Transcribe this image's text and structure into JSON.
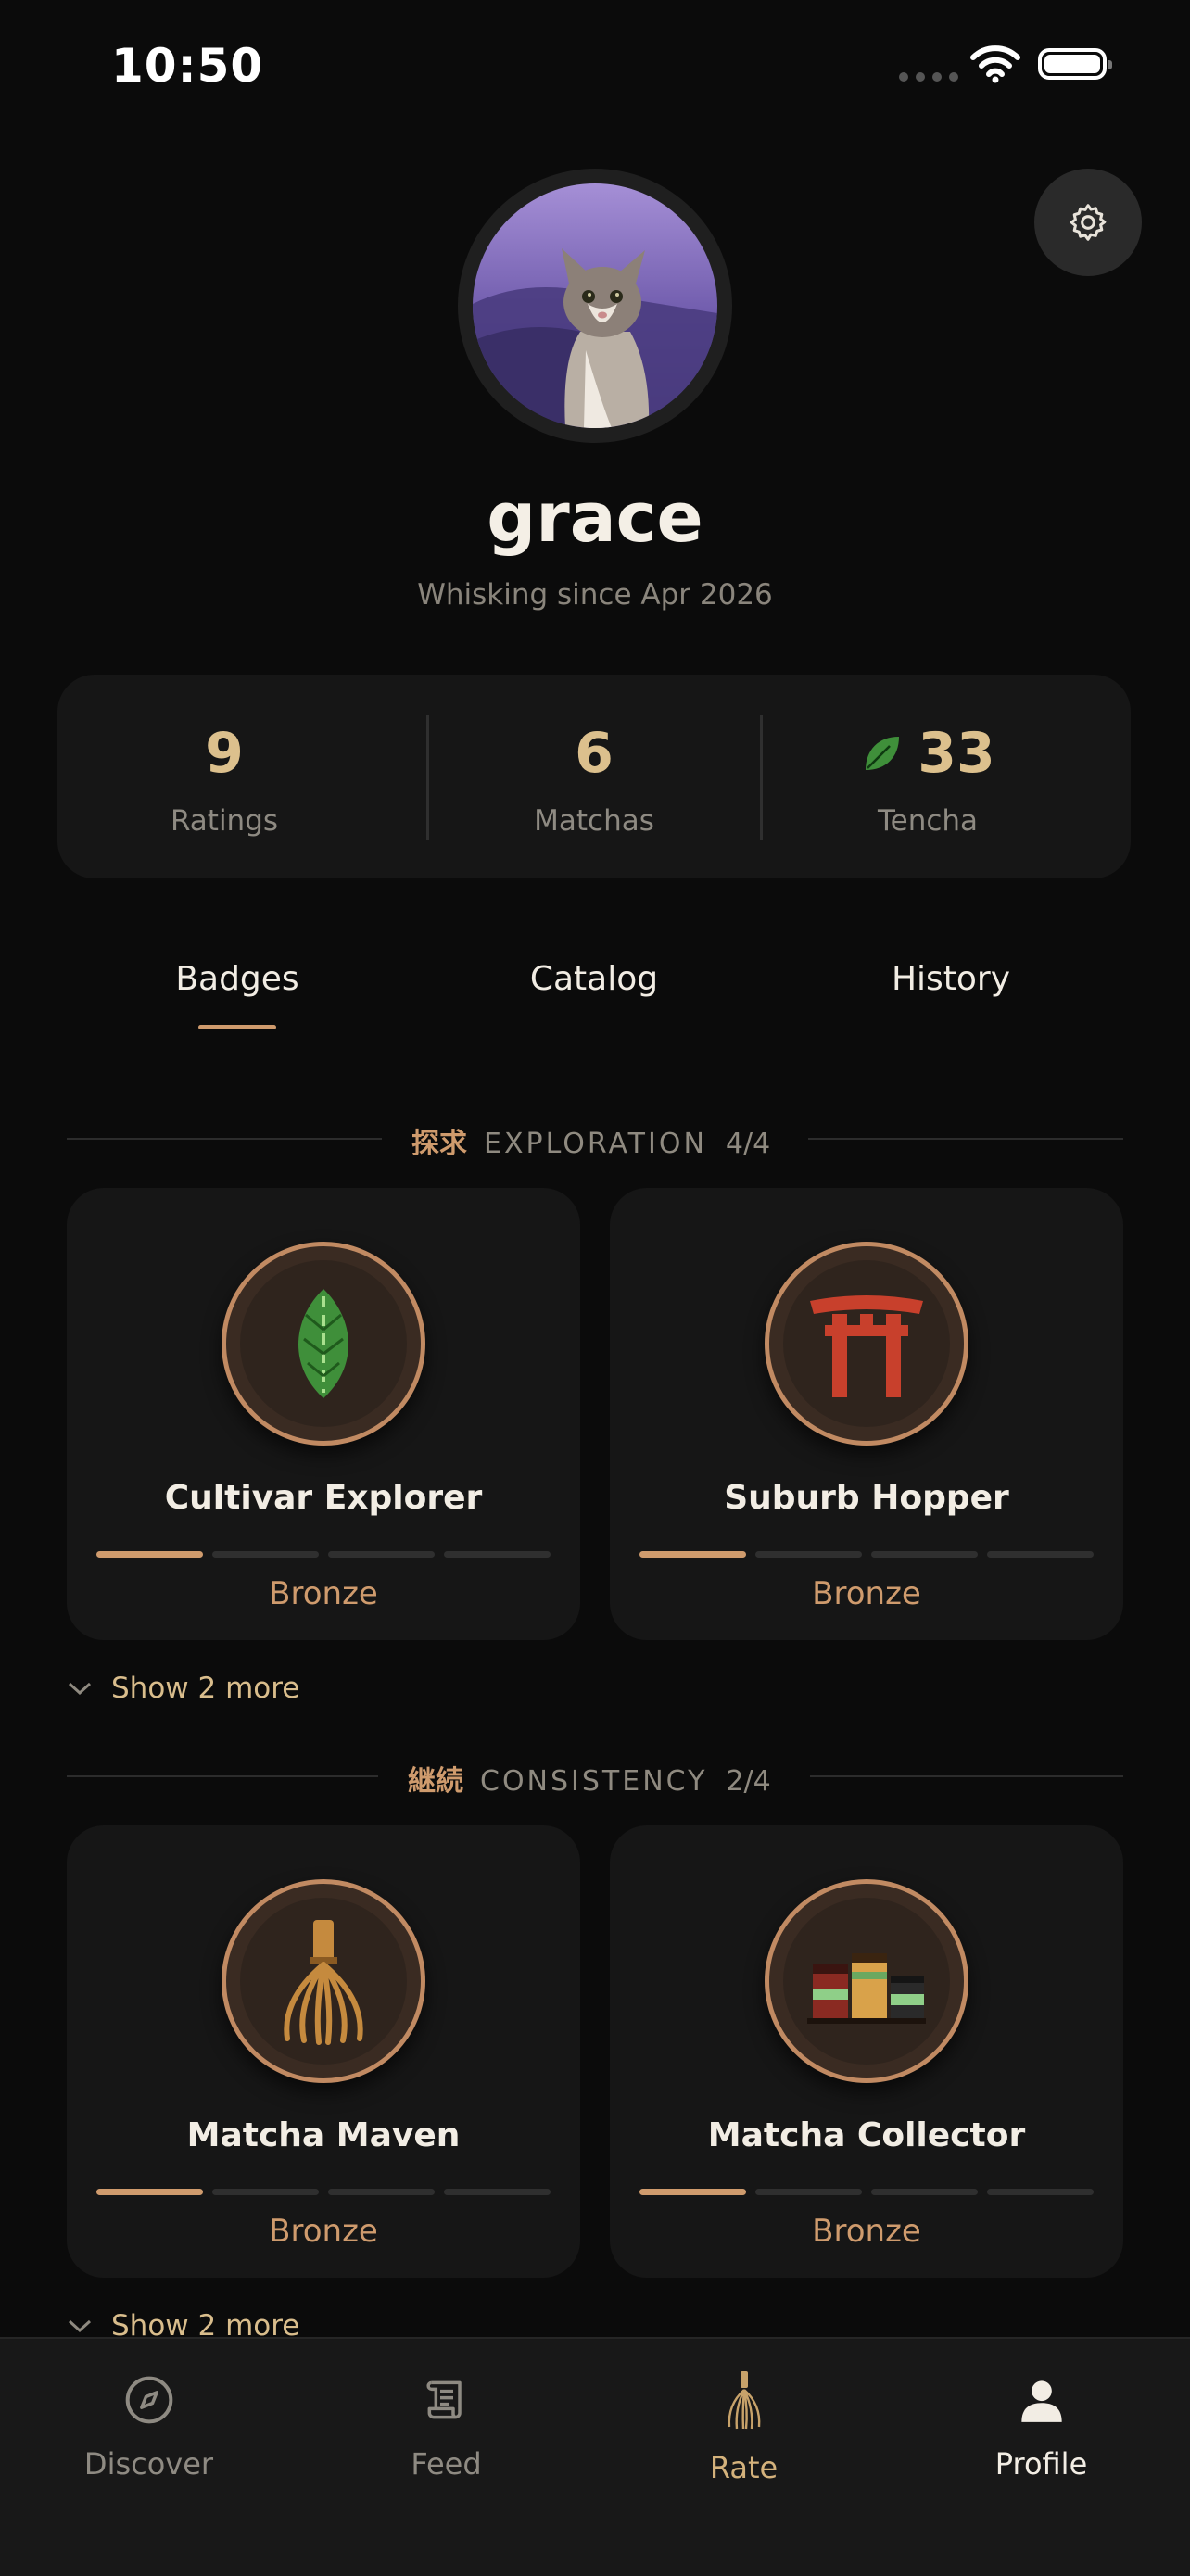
{
  "status_bar": {
    "time": "10:50"
  },
  "profile": {
    "username": "grace",
    "since": "Whisking since Apr 2026"
  },
  "stats": [
    {
      "value": "9",
      "label": "Ratings"
    },
    {
      "value": "6",
      "label": "Matchas"
    },
    {
      "value": "33",
      "label": "Tencha",
      "icon": "leaf-icon"
    }
  ],
  "tabs": [
    {
      "label": "Badges",
      "active": true
    },
    {
      "label": "Catalog",
      "active": false
    },
    {
      "label": "History",
      "active": false
    }
  ],
  "sections": [
    {
      "kanji": "探求",
      "title": "EXPLORATION",
      "count": "4/4",
      "badges": [
        {
          "name": "Cultivar Explorer",
          "tier": "Bronze",
          "level": 1,
          "levels": 4,
          "icon": "tea-leaf-icon"
        },
        {
          "name": "Suburb Hopper",
          "tier": "Bronze",
          "level": 1,
          "levels": 4,
          "icon": "torii-gate-icon"
        }
      ],
      "show_more": "Show 2 more"
    },
    {
      "kanji": "継続",
      "title": "CONSISTENCY",
      "count": "2/4",
      "badges": [
        {
          "name": "Matcha Maven",
          "tier": "Bronze",
          "level": 1,
          "levels": 4,
          "icon": "whisk-icon"
        },
        {
          "name": "Matcha Collector",
          "tier": "Bronze",
          "level": 1,
          "levels": 4,
          "icon": "tins-icon"
        }
      ],
      "show_more": "Show 2 more"
    }
  ],
  "nav": [
    {
      "label": "Discover",
      "icon": "compass-icon",
      "active": false
    },
    {
      "label": "Feed",
      "icon": "scroll-icon",
      "active": false
    },
    {
      "label": "Rate",
      "icon": "whisk-icon",
      "active": false
    },
    {
      "label": "Profile",
      "icon": "person-icon",
      "active": true
    }
  ],
  "colors": {
    "background": "#0b0b0b",
    "card": "#161616",
    "accent": "#cf9b6d",
    "stat_number": "#dcc08d",
    "leaf": "#3f8f3a"
  }
}
